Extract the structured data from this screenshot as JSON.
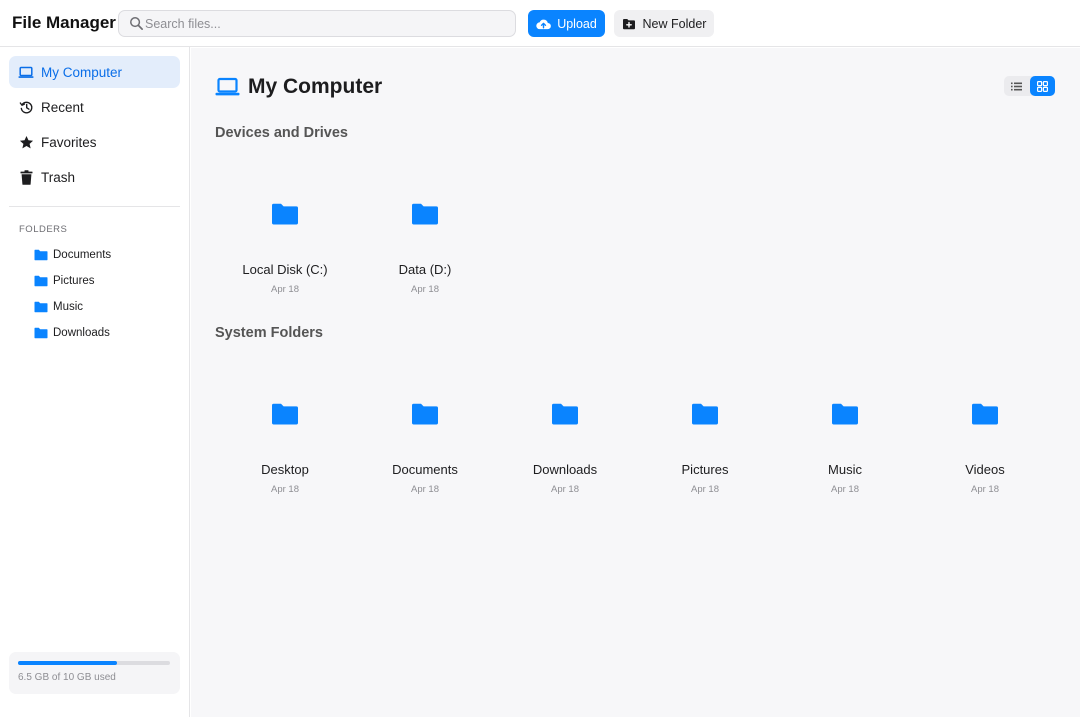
{
  "app": {
    "title": "File Manager"
  },
  "search": {
    "placeholder": "Search files...",
    "value": ""
  },
  "toolbar": {
    "upload_label": "Upload",
    "new_folder_label": "New Folder"
  },
  "sidebar": {
    "nav": [
      {
        "label": "My Computer",
        "icon": "laptop-icon",
        "active": true
      },
      {
        "label": "Recent",
        "icon": "history-icon",
        "active": false
      },
      {
        "label": "Favorites",
        "icon": "star-icon",
        "active": false
      },
      {
        "label": "Trash",
        "icon": "trash-icon",
        "active": false
      }
    ],
    "folders_heading": "FOLDERS",
    "folders": [
      {
        "label": "Documents"
      },
      {
        "label": "Pictures"
      },
      {
        "label": "Music"
      },
      {
        "label": "Downloads"
      }
    ],
    "storage": {
      "text": "6.5 GB of 10 GB used",
      "used_fraction": 0.65
    }
  },
  "main": {
    "title": "My Computer",
    "view_mode": "grid",
    "sections": [
      {
        "title": "Devices and Drives",
        "items": [
          {
            "name": "Local Disk (C:)",
            "date": "Apr 18"
          },
          {
            "name": "Data (D:)",
            "date": "Apr 18"
          }
        ]
      },
      {
        "title": "System Folders",
        "items": [
          {
            "name": "Desktop",
            "date": "Apr 18"
          },
          {
            "name": "Documents",
            "date": "Apr 18"
          },
          {
            "name": "Downloads",
            "date": "Apr 18"
          },
          {
            "name": "Pictures",
            "date": "Apr 18"
          },
          {
            "name": "Music",
            "date": "Apr 18"
          },
          {
            "name": "Videos",
            "date": "Apr 18"
          }
        ]
      }
    ]
  },
  "colors": {
    "accent": "#0a84ff",
    "folder": "#0a84ff",
    "active_bg": "#e3edfb"
  }
}
